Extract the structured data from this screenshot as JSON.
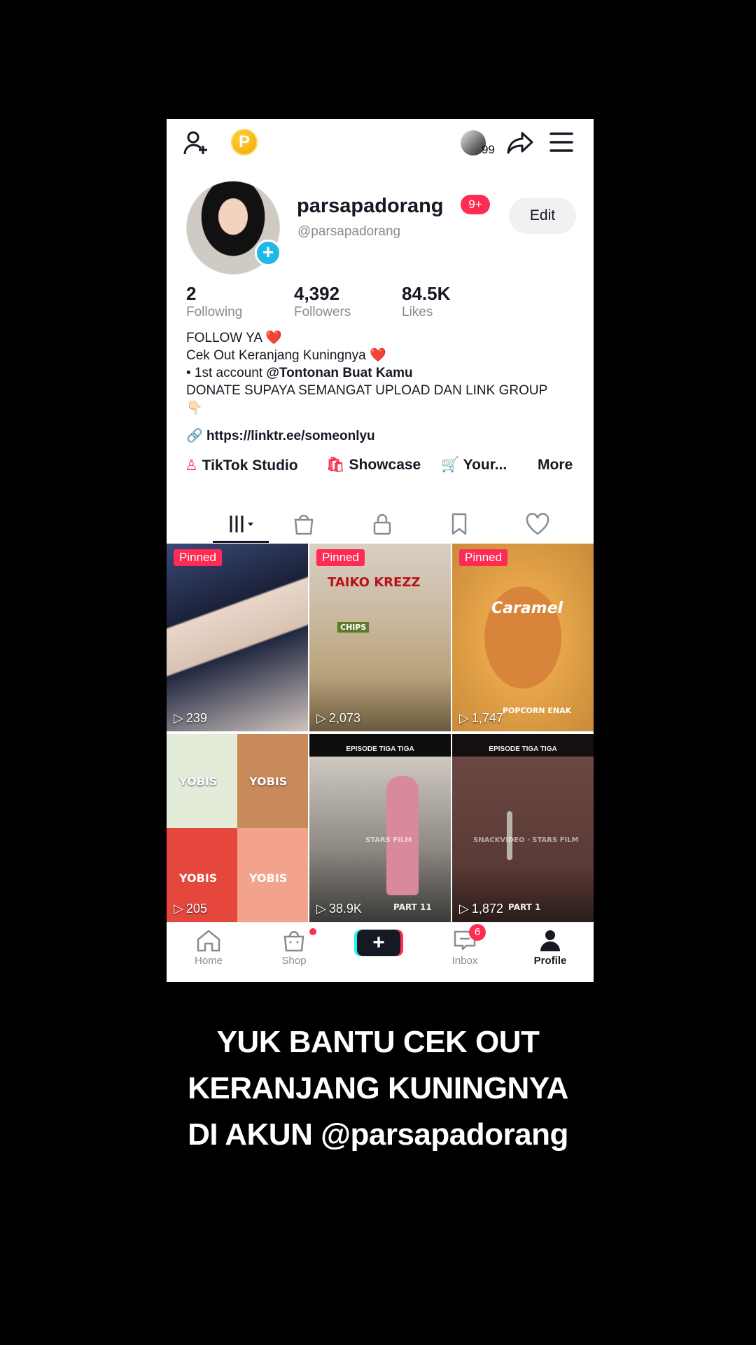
{
  "profile": {
    "username": "parsapadorang",
    "notif_badge": "9+",
    "handle": "@parsapadorang",
    "edit_label": "Edit",
    "mini_avatar_count": "99",
    "coin_letter": "P",
    "stats": [
      {
        "value": "2",
        "label": "Following"
      },
      {
        "value": "4,392",
        "label": "Followers"
      },
      {
        "value": "84.5K",
        "label": "Likes"
      }
    ],
    "bio": {
      "line1": "FOLLOW YA ❤️",
      "line2": "Cek Out Keranjang Kuningnya ❤️",
      "line3_prefix": "• 1st account ",
      "line3_mention": "@Tontonan Buat Kamu",
      "line4": "DONATE SUPAYA SEMANGAT UPLOAD DAN LINK GROUP",
      "line5": "👇🏻"
    },
    "link": "https://linktr.ee/someonlyu",
    "pills": {
      "studio": "TikTok Studio",
      "showcase": "Showcase",
      "your": "Your...",
      "more": "More"
    }
  },
  "videos": [
    {
      "views": "239",
      "pinned": "Pinned"
    },
    {
      "views": "2,073",
      "pinned": "Pinned",
      "brand": "TAIKO KREZZ",
      "sub": "CHIPS"
    },
    {
      "views": "1,747",
      "pinned": "Pinned",
      "brand": "Caramel",
      "sub": "POPCORN ENAK"
    },
    {
      "views": "205",
      "brand": "YOBIS"
    },
    {
      "views": "38.9K",
      "caption": "EPISODE TIGA TIGA",
      "part": "PART 11",
      "watermark": "STARS FILM"
    },
    {
      "views": "1,872",
      "caption": "EPISODE TIGA TIGA",
      "part": "PART 1",
      "watermark": "SNACKVIDEO · STARS FILM"
    }
  ],
  "nav": {
    "home": "Home",
    "shop": "Shop",
    "inbox": "Inbox",
    "inbox_badge": "6",
    "profile": "Profile"
  },
  "overlay_caption": {
    "line1": "YUK BANTU CEK OUT",
    "line2": "KERANJANG KUNINGNYA",
    "line3": "DI AKUN @parsapadorang"
  },
  "colors": {
    "accent": "#fe2c55",
    "text": "#161823",
    "muted": "#8a8b91"
  }
}
